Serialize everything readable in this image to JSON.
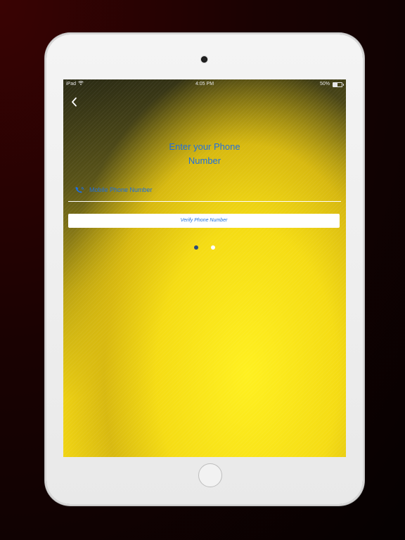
{
  "status_bar": {
    "device": "iPad",
    "time": "4:05 PM",
    "battery_text": "50%",
    "battery_level": 0.5
  },
  "nav": {
    "back_icon": "chevron-left-icon"
  },
  "screen": {
    "title": "Enter your Phone Number",
    "phone_icon": "phone-icon",
    "phone_input": {
      "value": "",
      "placeholder": "Mobile Phone Number"
    },
    "verify_button_label": "Verify Phone Number",
    "page_indicator": {
      "count": 2,
      "active_index": 0
    }
  },
  "colors": {
    "accent": "#1e6fe0",
    "dot_active": "#2c4a78",
    "dot_inactive": "#ffffff"
  }
}
